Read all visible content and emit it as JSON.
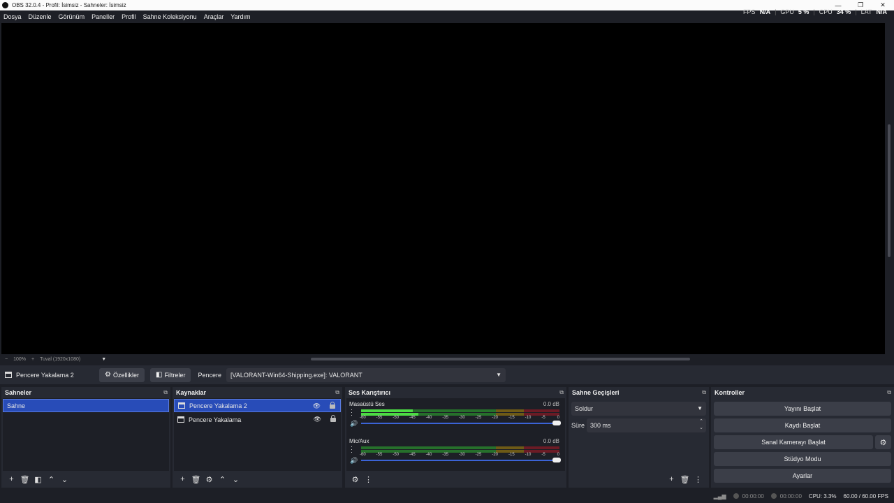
{
  "window": {
    "title": "OBS 32.0.4 - Profil: İsimsiz - Sahneler: İsimsiz",
    "controls": [
      "minimize-icon",
      "maximize-icon",
      "close-icon"
    ]
  },
  "menu": [
    "Dosya",
    "Düzenle",
    "Görünüm",
    "Paneller",
    "Profil",
    "Sahne Koleksiyonu",
    "Araçlar",
    "Yardım"
  ],
  "stats": {
    "fps_label": "FPS",
    "fps_value": "N/A",
    "gpu_label": "GPU",
    "gpu_value": "5 %",
    "cpu_label": "CPU",
    "cpu_value": "34 %",
    "lat_label": "LAT",
    "lat_value": "N/A"
  },
  "zoom": {
    "minus": "−",
    "value": "100%",
    "plus": "+",
    "canvas": "Tuval (1920x1080)"
  },
  "source_toolbar": {
    "source_name": "Pencere Yakalama 2",
    "properties_label": "Özellikler",
    "filters_label": "Filtreler",
    "window_label": "Pencere",
    "window_value": "[VALORANT-Win64-Shipping.exe]: VALORANT"
  },
  "docks": {
    "scenes": {
      "title": "Sahneler",
      "items": [
        "Sahne"
      ]
    },
    "sources": {
      "title": "Kaynaklar",
      "items": [
        "Pencere Yakalama 2",
        "Pencere Yakalama"
      ]
    },
    "mixer": {
      "title": "Ses Karıştırıcı",
      "channels": [
        {
          "name": "Masaüstü Ses",
          "db": "0.0 dB",
          "level": 0.29
        },
        {
          "name": "Mic/Aux",
          "db": "0.0 dB",
          "level": 0
        }
      ],
      "ticks": [
        "-60",
        "-55",
        "-50",
        "-45",
        "-40",
        "-35",
        "-30",
        "-25",
        "-20",
        "-15",
        "-10",
        "-5",
        "0"
      ]
    },
    "transitions": {
      "title": "Sahne Geçişleri",
      "transition": "Soldur",
      "duration_label": "Süre",
      "duration_value": "300 ms"
    },
    "controls": {
      "title": "Kontroller",
      "buttons": [
        "Yayını Başlat",
        "Kaydı Başlat",
        "Sanal Kamerayı Başlat",
        "Stüdyo Modu",
        "Ayarlar"
      ]
    }
  },
  "status": {
    "stream_time": "00:00:00",
    "record_time": "00:00:00",
    "cpu": "CPU: 3.3%",
    "fps": "60.00 / 60.00 FPS"
  },
  "colors": {
    "accent": "#284cb8",
    "meter_green": "#4cdc44",
    "background": "#1d1f26",
    "dock": "#272a33"
  }
}
